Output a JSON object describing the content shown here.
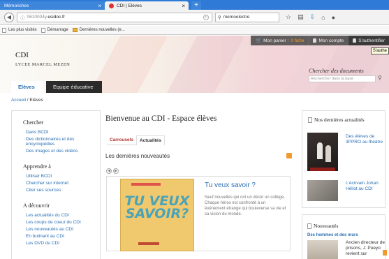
{
  "browser": {
    "tabs": [
      {
        "label": "Mémoriches"
      },
      {
        "label": "CDI | Elèves"
      }
    ],
    "close_glyph": "×",
    "newtab_glyph": "+",
    "url_host_prefix": "0610004y.",
    "url_host_bold": "esidoc.fr",
    "search_value": "memoelectre",
    "bookmarks": [
      "Les plus visités",
      "Démarrage",
      "Dernières nouvelles (e..."
    ],
    "icons": [
      "back-icon",
      "info-icon",
      "refresh-icon",
      "search-icon",
      "star-icon",
      "bookmark-list-icon",
      "download-icon",
      "home-icon",
      "chat-icon"
    ]
  },
  "site": {
    "title": "CDI",
    "subtitle": "LYCEE MARCEL MEZEN",
    "topbar": {
      "cart_label": "Mon panier :",
      "cart_count": "0 fiche",
      "account": "Mon compte",
      "login": "S'authentifier",
      "tooltip": "S'authe"
    },
    "search": {
      "label": "Chercher des documents",
      "placeholder": "Rechercher dans la base"
    },
    "nav": {
      "eleves": "Elèves",
      "equipe": "Equipe éducative"
    },
    "breadcrumb": {
      "home": "Accueil",
      "sep": "/",
      "current": "Elèves"
    }
  },
  "sidebar": {
    "sections": [
      {
        "heading": "Chercher",
        "links": [
          "Dans BCDI",
          "Des dictionnaires et des encyclopédies",
          "Des images et des vidéos"
        ]
      },
      {
        "heading": "Apprendre à",
        "links": [
          "Utiliser BCDI",
          "Chercher sur internet",
          "Citer ses sources"
        ]
      },
      {
        "heading": "A découvrir",
        "links": [
          "Les actualités du CDI",
          "Les coups de coeur du CDI",
          "Les nouveautés au CDI",
          "En butinant au CDI",
          "Les DVD du CDI"
        ]
      }
    ]
  },
  "main": {
    "welcome": "Bienvenue au CDI - Espace élèves",
    "tabs": [
      "Carrousels",
      "Actualités"
    ],
    "section_title": "Les dernières nouveautés",
    "slide": {
      "book_title": "TU VEUX SAVOIR?",
      "title": "Tu veux savoir ?",
      "text": "Neuf nouvelles qui ont un décor un collège. Chaque héros est confronté à un événement étrange qui bouleverse sa vie et sa vision du monde."
    }
  },
  "right": {
    "news_heading": "Nos dernières actualités",
    "news": [
      "Des élèves de 3PPRO au théâtre",
      "L'écrivain Johan Héliot au CDI"
    ],
    "nouv_heading": "Nouveautés",
    "nouv_sub": "Des hommes et des murs",
    "nouv_text": "Ancien directeur de prisons, J. Pueyo revient sur"
  },
  "colors": {
    "link": "#2a6fb5",
    "tab_bar": "#2f7ad6",
    "rss": "#f09a2f",
    "accent_red": "#b3302a"
  }
}
